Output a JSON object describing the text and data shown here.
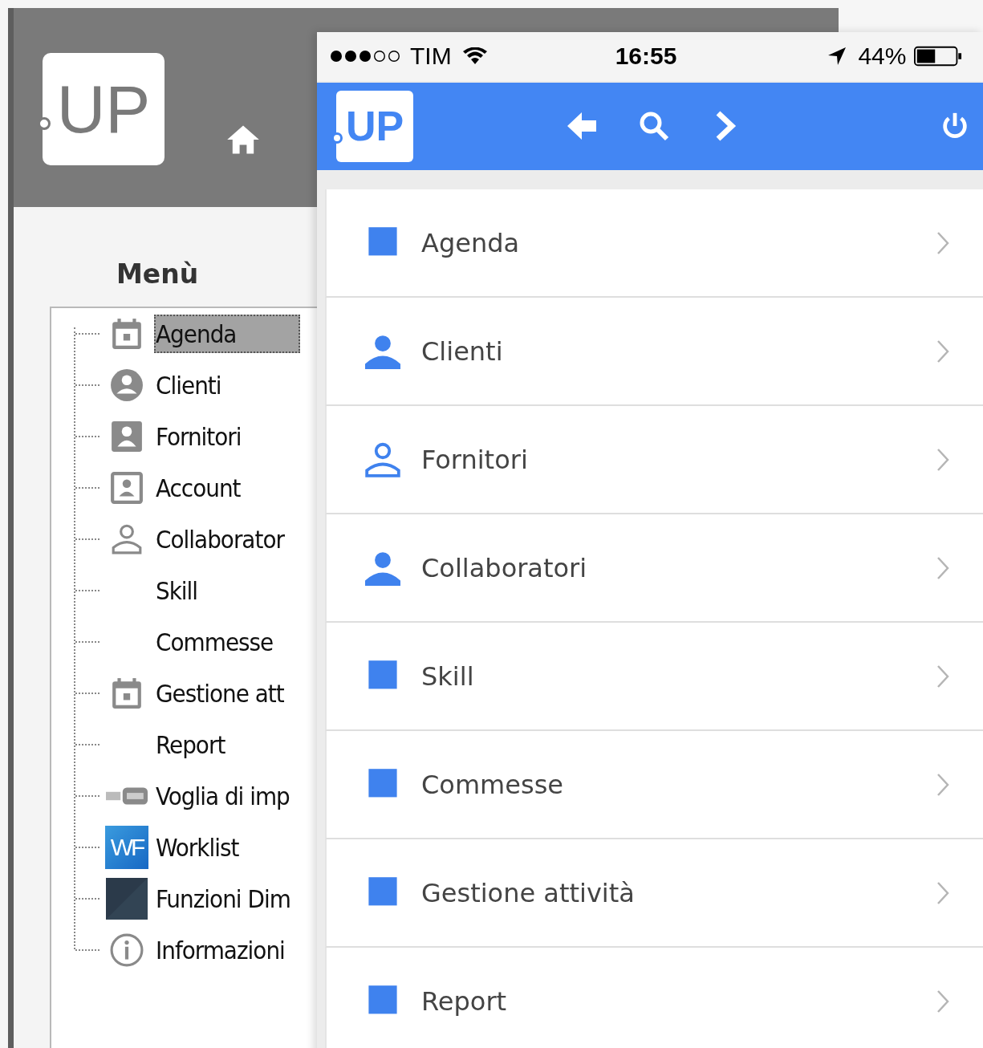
{
  "desktop": {
    "logo": "UP",
    "menu_title": "Menù",
    "tree": [
      {
        "label": "Agenda",
        "kind": "calendar",
        "selected": true
      },
      {
        "label": "Clienti",
        "kind": "person-circle",
        "selected": false
      },
      {
        "label": "Fornitori",
        "kind": "person-card",
        "selected": false
      },
      {
        "label": "Account",
        "kind": "person-frame",
        "selected": false
      },
      {
        "label": "Collaborator",
        "kind": "person-outline",
        "selected": false
      },
      {
        "label": "Skill",
        "kind": "none",
        "selected": false
      },
      {
        "label": "Commesse",
        "kind": "none",
        "selected": false
      },
      {
        "label": "Gestione att",
        "kind": "calendar",
        "selected": false
      },
      {
        "label": "Report",
        "kind": "none",
        "selected": false
      },
      {
        "label": "Voglia di imp",
        "kind": "video",
        "selected": false
      },
      {
        "label": "Worklist",
        "kind": "wf",
        "selected": false,
        "badge": "WF"
      },
      {
        "label": "Funzioni Dim",
        "kind": "tile",
        "selected": false
      },
      {
        "label": "Informazioni",
        "kind": "info",
        "selected": false
      }
    ]
  },
  "phone": {
    "status_bar": {
      "carrier": "TIM",
      "time": "16:55",
      "battery": "44%"
    },
    "logo": "UP",
    "items": [
      {
        "label": "Agenda",
        "kind": "square"
      },
      {
        "label": "Clienti",
        "kind": "person"
      },
      {
        "label": "Fornitori",
        "kind": "person-outline"
      },
      {
        "label": "Collaboratori",
        "kind": "person"
      },
      {
        "label": "Skill",
        "kind": "square"
      },
      {
        "label": "Commesse",
        "kind": "square"
      },
      {
        "label": "Gestione attività",
        "kind": "square"
      },
      {
        "label": "Report",
        "kind": "square"
      }
    ]
  }
}
